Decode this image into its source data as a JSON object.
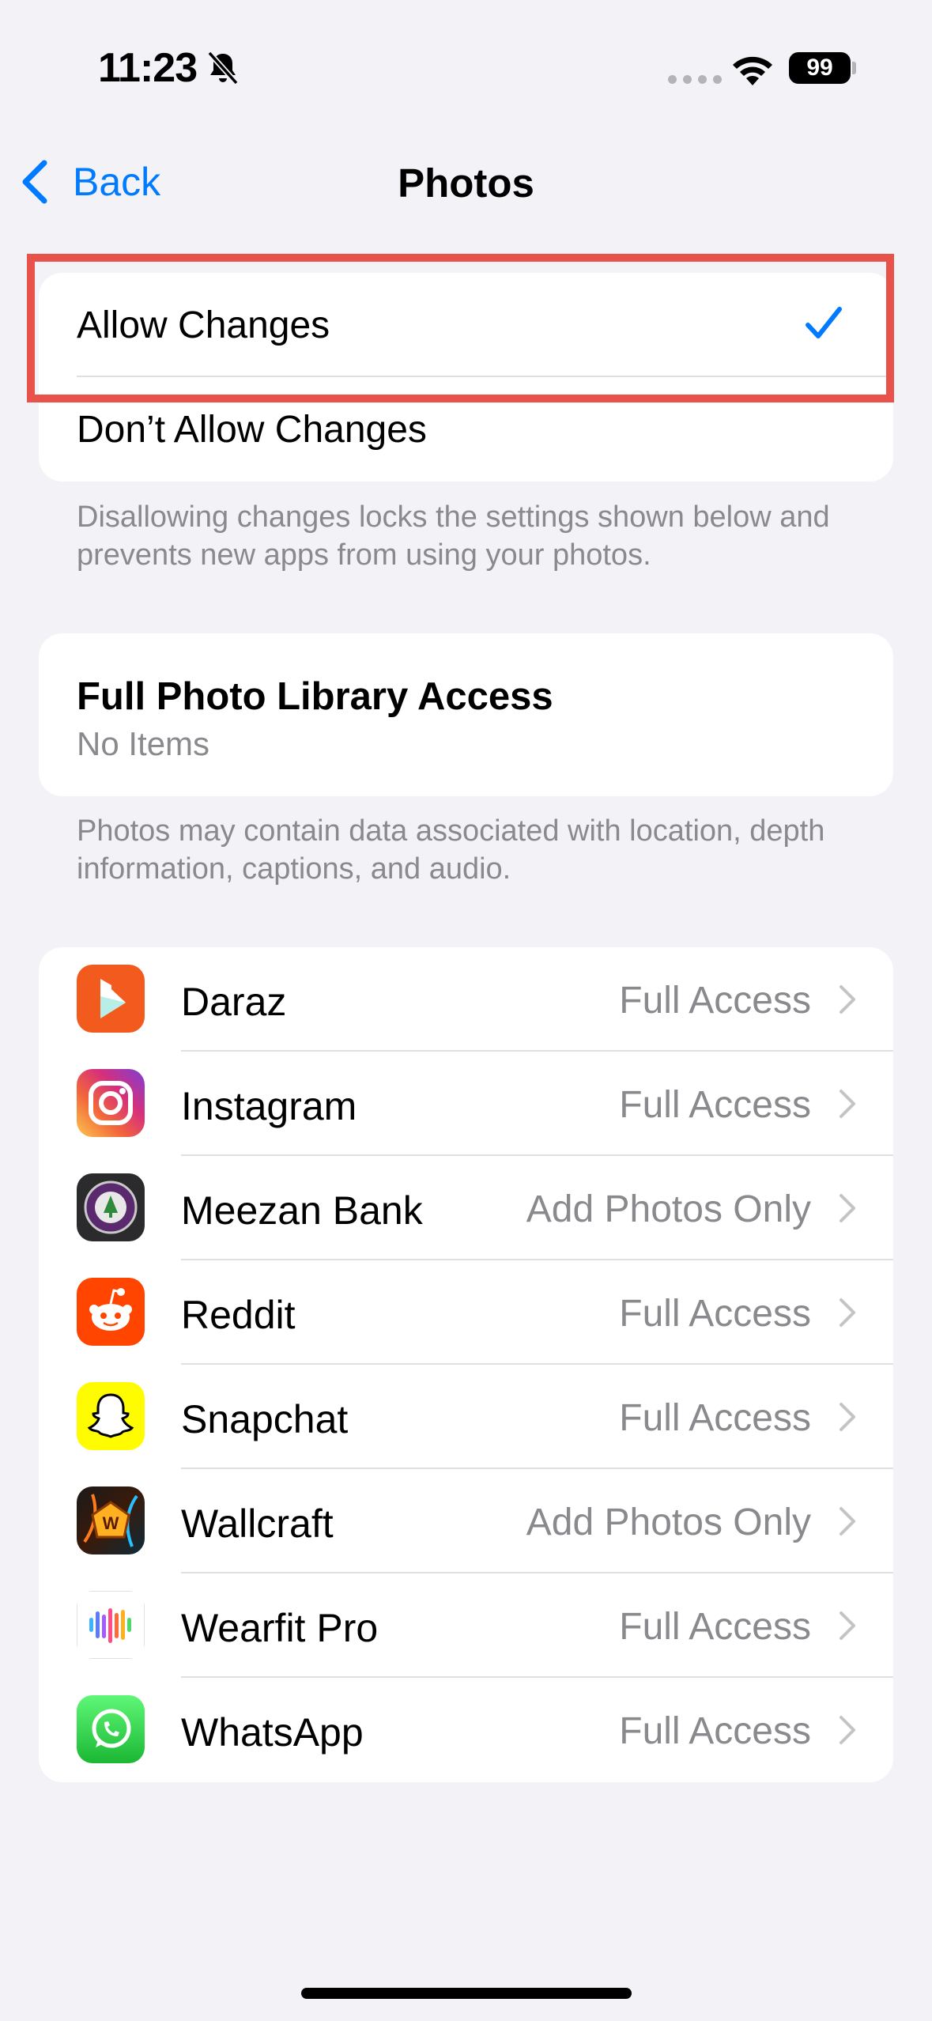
{
  "status_bar": {
    "time": "11:23",
    "battery": "99"
  },
  "nav": {
    "back_label": "Back",
    "title": "Photos"
  },
  "changes_group": {
    "options": [
      {
        "label": "Allow Changes",
        "selected": true
      },
      {
        "label": "Don’t Allow Changes",
        "selected": false
      }
    ],
    "footer": "Disallowing changes locks the settings shown below and prevents new apps from using your photos."
  },
  "library_group": {
    "title": "Full Photo Library Access",
    "subtitle": "No Items",
    "footer": "Photos may contain data associated with location, depth information, captions, and audio."
  },
  "apps": [
    {
      "name": "Daraz",
      "access": "Full Access",
      "icon": "daraz-icon"
    },
    {
      "name": "Instagram",
      "access": "Full Access",
      "icon": "instagram-icon"
    },
    {
      "name": "Meezan Bank",
      "access": "Add Photos Only",
      "icon": "meezan-bank-icon"
    },
    {
      "name": "Reddit",
      "access": "Full Access",
      "icon": "reddit-icon"
    },
    {
      "name": "Snapchat",
      "access": "Full Access",
      "icon": "snapchat-icon"
    },
    {
      "name": "Wallcraft",
      "access": "Add Photos Only",
      "icon": "wallcraft-icon"
    },
    {
      "name": "Wearfit Pro",
      "access": "Full Access",
      "icon": "wearfit-pro-icon"
    },
    {
      "name": "WhatsApp",
      "access": "Full Access",
      "icon": "whatsapp-icon"
    }
  ],
  "colors": {
    "accent": "#007aff",
    "highlight": "#e8524a",
    "background": "#f2f2f7"
  }
}
